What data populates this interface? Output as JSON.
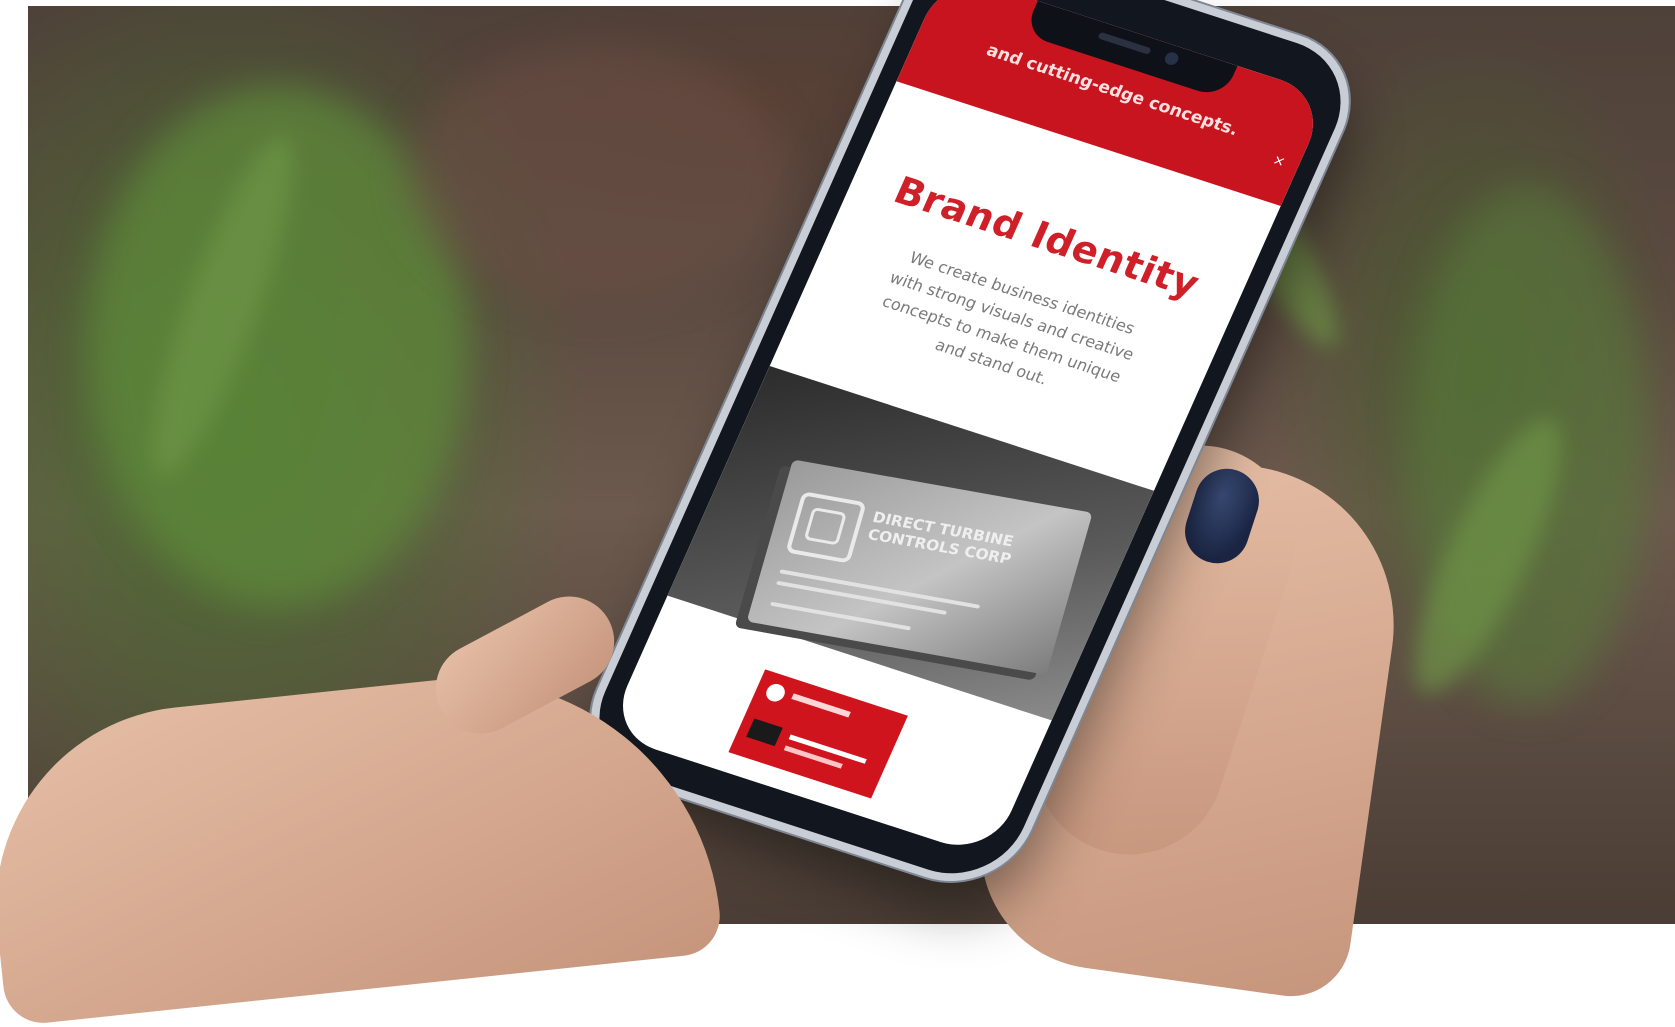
{
  "scene": {
    "description_type": "photograph",
    "subject": "phone-mockup"
  },
  "screen": {
    "top_banner_text": "and cutting-edge concepts.",
    "heading": "Brand Identity",
    "description": "We create business identities with strong visuals and creative concepts to make them unique and stand out.",
    "card_company": "DIRECT TURBINE CONTROLS Corp"
  },
  "colors": {
    "brand_red": "#c8141f",
    "heading_red": "#cf1f28",
    "nail_polish": "#1b2544"
  }
}
